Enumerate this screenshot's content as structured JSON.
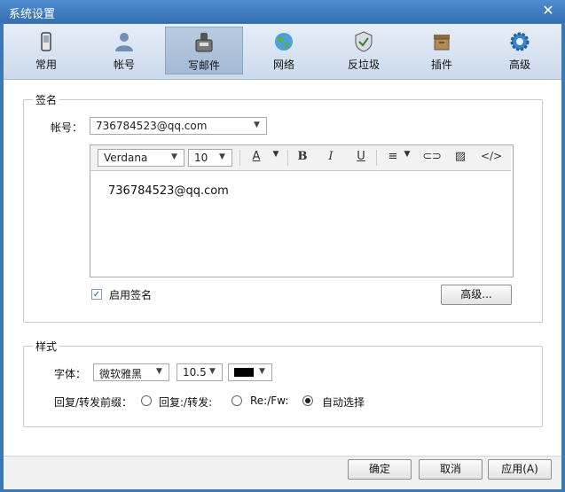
{
  "window": {
    "title": "系统设置"
  },
  "toolbar": {
    "items": [
      {
        "label": "常用",
        "icon": "phone-icon"
      },
      {
        "label": "帐号",
        "icon": "user-icon"
      },
      {
        "label": "写邮件",
        "icon": "compose-icon",
        "active": true
      },
      {
        "label": "网络",
        "icon": "globe-icon"
      },
      {
        "label": "反垃圾",
        "icon": "shield-icon"
      },
      {
        "label": "插件",
        "icon": "plugin-box-icon"
      },
      {
        "label": "高级",
        "icon": "gear-icon"
      }
    ]
  },
  "signature": {
    "legend": "签名",
    "account_label": "帐号：",
    "account_value": "736784523@qq.com",
    "editor": {
      "font": "Verdana",
      "size": "10",
      "body_text": "736784523@qq.com"
    },
    "enable_label": "启用签名",
    "enabled": true,
    "advanced_button": "高级..."
  },
  "style": {
    "legend": "样式",
    "font_label": "字体：",
    "font_value": "微软雅黑",
    "size_value": "10.5",
    "color_value": "#000000",
    "prefix_label": "回复/转发前缀：",
    "options": [
      {
        "label": "回复:/转发:",
        "selected": false
      },
      {
        "label": "Re:/Fw:",
        "selected": false
      },
      {
        "label": "自动选择",
        "selected": true
      }
    ]
  },
  "footer": {
    "ok": "确定",
    "cancel": "取消",
    "apply": "应用(A)"
  },
  "colors": {
    "titlebar": "#3470b0",
    "toolbar": "#cbdaec"
  }
}
